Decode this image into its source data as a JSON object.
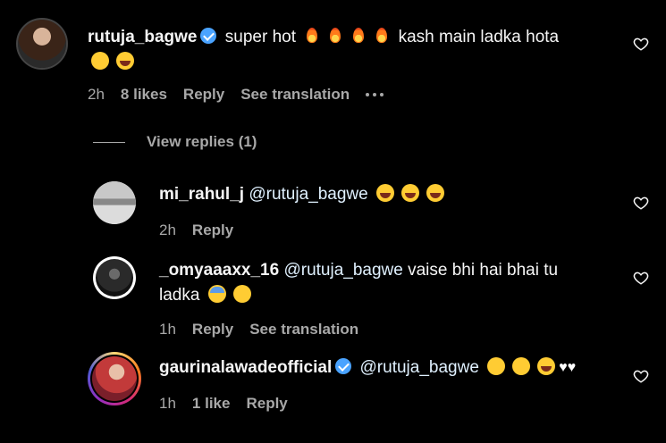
{
  "comments": [
    {
      "username": "rutuja_bagwe",
      "text_part1": "super hot",
      "text_part2": "kash main ladka hota",
      "time": "2h",
      "likes": "8 likes",
      "reply": "Reply",
      "see_translation": "See translation"
    }
  ],
  "view_replies": "View replies (1)",
  "replies": [
    {
      "username": "mi_rahul_j",
      "mention": "@rutuja_bagwe",
      "time": "2h",
      "reply": "Reply"
    },
    {
      "username": "_omyaaaxx_16",
      "mention": "@rutuja_bagwe",
      "text_line1": "vaise bhi hai bhai tu",
      "text_line2": "ladka",
      "time": "1h",
      "reply": "Reply",
      "see_translation": "See translation"
    },
    {
      "username": "gaurinalawadeofficial",
      "mention": "@rutuja_bagwe",
      "time": "1h",
      "likes": "1 like",
      "reply": "Reply"
    }
  ],
  "icons": {
    "verified": "verified-badge-icon",
    "like": "heart-outline-icon",
    "more": "more-dots-icon"
  },
  "colors": {
    "background": "#000000",
    "text": "#f5f5f5",
    "secondary": "#a8a8a8",
    "verified": "#4aa3ff"
  }
}
